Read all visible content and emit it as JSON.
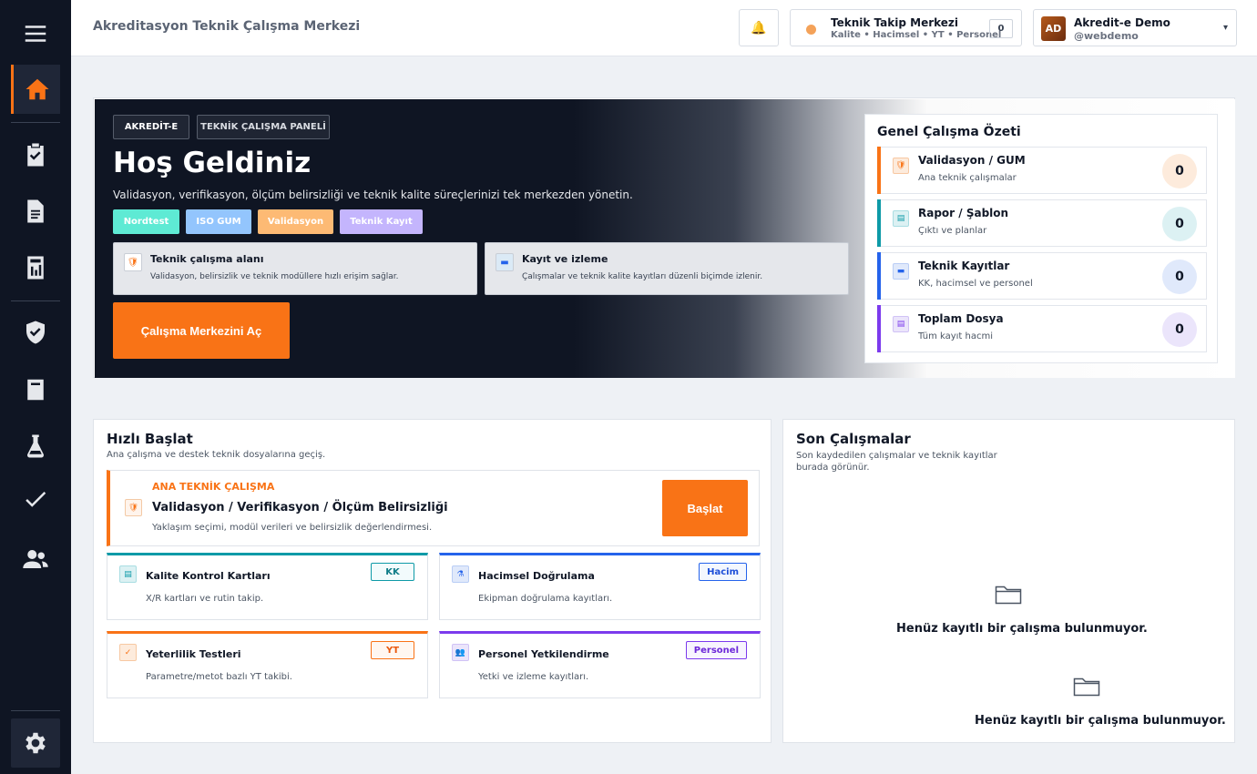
{
  "app": {
    "title": "Akreditasyon Teknik Çalışma Merkezi"
  },
  "sidebar": {
    "items": [
      {
        "name": "menu-icon"
      },
      {
        "name": "home-icon"
      },
      {
        "name": "clipboard-check-icon"
      },
      {
        "name": "document-icon"
      },
      {
        "name": "calculator-icon"
      },
      {
        "name": "shield-check-icon"
      },
      {
        "name": "book-icon"
      },
      {
        "name": "flask-icon"
      },
      {
        "name": "check-icon"
      },
      {
        "name": "users-icon"
      },
      {
        "name": "gear-icon"
      }
    ]
  },
  "header": {
    "notification_icon": "bell-icon",
    "takip": {
      "title": "Teknik Takip Merkezi",
      "subtitle": "Kalite • Hacimsel • YT • Personel",
      "count": "0"
    },
    "user": {
      "initials": "AD",
      "name": "Akredit-e Demo",
      "handle": "@webdemo",
      "chevron": "▾"
    }
  },
  "hero": {
    "chips": [
      "AKREDİT-E",
      "TEKNİK ÇALIŞMA PANELİ"
    ],
    "title": "Hoş Geldiniz",
    "subtitle": "Validasyon, verifikasyon, ölçüm belirsizliği ve teknik kalite süreçlerinizi tek merkezden yönetin.",
    "tags": [
      {
        "label": "Nordtest",
        "color": "#5eead4"
      },
      {
        "label": "ISO GUM",
        "color": "#93c5fd"
      },
      {
        "label": "Validasyon",
        "color": "#fdba74"
      },
      {
        "label": "Teknik Kayıt",
        "color": "#c4b5fd"
      }
    ],
    "info": [
      {
        "icon": "shield-icon",
        "title": "Teknik çalışma alanı",
        "desc": "Validasyon, belirsizlik ve teknik modüllere hızlı erişim sağlar."
      },
      {
        "icon": "folder-icon",
        "title": "Kayıt ve izleme",
        "desc": "Çalışmalar ve teknik kalite kayıtları düzenli biçimde izlenir."
      }
    ],
    "cta": "Çalışma Merkezini Aç"
  },
  "summary": {
    "title": "Genel Çalışma Özeti",
    "rows": [
      {
        "title": "Validasyon / GUM",
        "sub": "Ana teknik çalışmalar",
        "count": "0",
        "accent": "#f97316",
        "bg": "#fdebdc",
        "icon": "shield-icon"
      },
      {
        "title": "Rapor / Şablon",
        "sub": "Çıktı ve planlar",
        "count": "0",
        "accent": "#0e9aa7",
        "bg": "#dcf1f3",
        "icon": "report-icon"
      },
      {
        "title": "Teknik Kayıtlar",
        "sub": "KK, hacimsel ve personel",
        "count": "0",
        "accent": "#2563eb",
        "bg": "#e0e9fb",
        "icon": "folder-icon"
      },
      {
        "title": "Toplam Dosya",
        "sub": "Tüm kayıt hacmi",
        "count": "0",
        "accent": "#7c3aed",
        "bg": "#ebe5fb",
        "icon": "file-icon"
      }
    ]
  },
  "quick": {
    "title": "Hızlı Başlat",
    "subtitle": "Ana çalışma ve destek teknik dosyalarına geçiş.",
    "main": {
      "kicker": "ANA TEKNİK ÇALIŞMA",
      "title": "Validasyon / Verifikasyon / Ölçüm Belirsizliği",
      "desc": "Yaklaşım seçimi, modül verileri ve belirsizlik değerlendirmesi.",
      "button": "Başlat"
    },
    "cards": [
      {
        "title": "Kalite Kontrol Kartları",
        "desc": "X/R kartları ve rutin takip.",
        "badge": "KK",
        "color": "#0e9aa7",
        "icon": "chart-icon"
      },
      {
        "title": "Hacimsel Doğrulama",
        "desc": "Ekipman doğrulama kayıtları.",
        "badge": "Hacim",
        "color": "#2563eb",
        "icon": "flask-icon"
      },
      {
        "title": "Yeterlilik Testleri",
        "desc": "Parametre/metot bazlı YT takibi.",
        "badge": "YT",
        "color": "#f97316",
        "icon": "check-icon"
      },
      {
        "title": "Personel Yetkilendirme",
        "desc": "Yetki ve izleme kayıtları.",
        "badge": "Personel",
        "color": "#7c3aed",
        "icon": "users-icon"
      }
    ]
  },
  "recent": {
    "title": "Son Çalışmalar",
    "subtitle": "Son kaydedilen çalışmalar ve teknik kayıtlar burada görünür.",
    "empty": [
      "Henüz kayıtlı bir çalışma bulunmuyor.",
      "Henüz kayıtlı bir çalışma bulunmuyor."
    ]
  }
}
